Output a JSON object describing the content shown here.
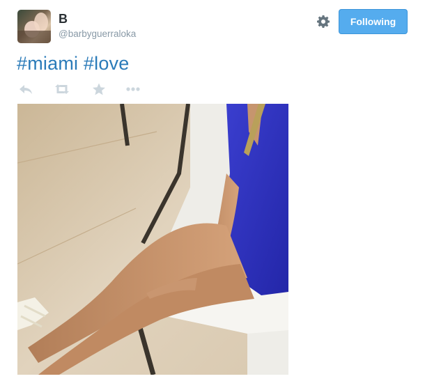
{
  "tweet": {
    "author_name": "B",
    "author_handle": "@barbyguerraloka",
    "follow_button_label": "Following",
    "hashtags": [
      "#miami",
      "#love"
    ]
  },
  "icons": {
    "settings": "gear-icon",
    "reply": "reply-icon",
    "retweet": "retweet-icon",
    "favorite": "star-icon",
    "more": "more-icon"
  },
  "colors": {
    "accent": "#55acee",
    "hashtag": "#2b7bb9",
    "muted": "#8899a6",
    "action_icon": "#ccd6dd"
  }
}
